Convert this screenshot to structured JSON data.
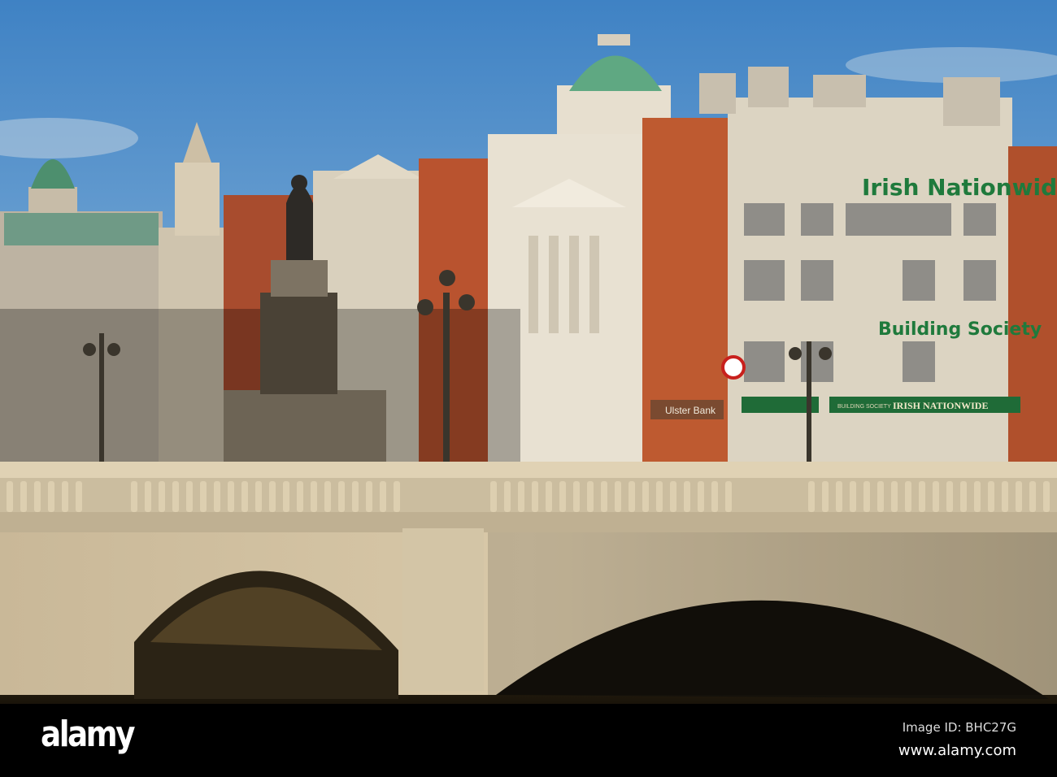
{
  "photo": {
    "signs": {
      "irish_nationwide_top": "Irish Nationwide",
      "building_society": "Building Society",
      "ulster_bank": "Ulster Bank",
      "irish_nationwide_fascia": "IRISH NATIONWIDE",
      "building_society_small": "BUILDING SOCIETY"
    },
    "colors": {
      "sky": "#4f8fc8",
      "dome": "#5fa882",
      "brick": "#b5502e",
      "stone": "#d8c9ad",
      "sign_green": "#1f7a3c"
    }
  },
  "watermark": {
    "logo": "alamy",
    "image_id": "Image ID: BHC27G",
    "site": "www.alamy.com"
  }
}
